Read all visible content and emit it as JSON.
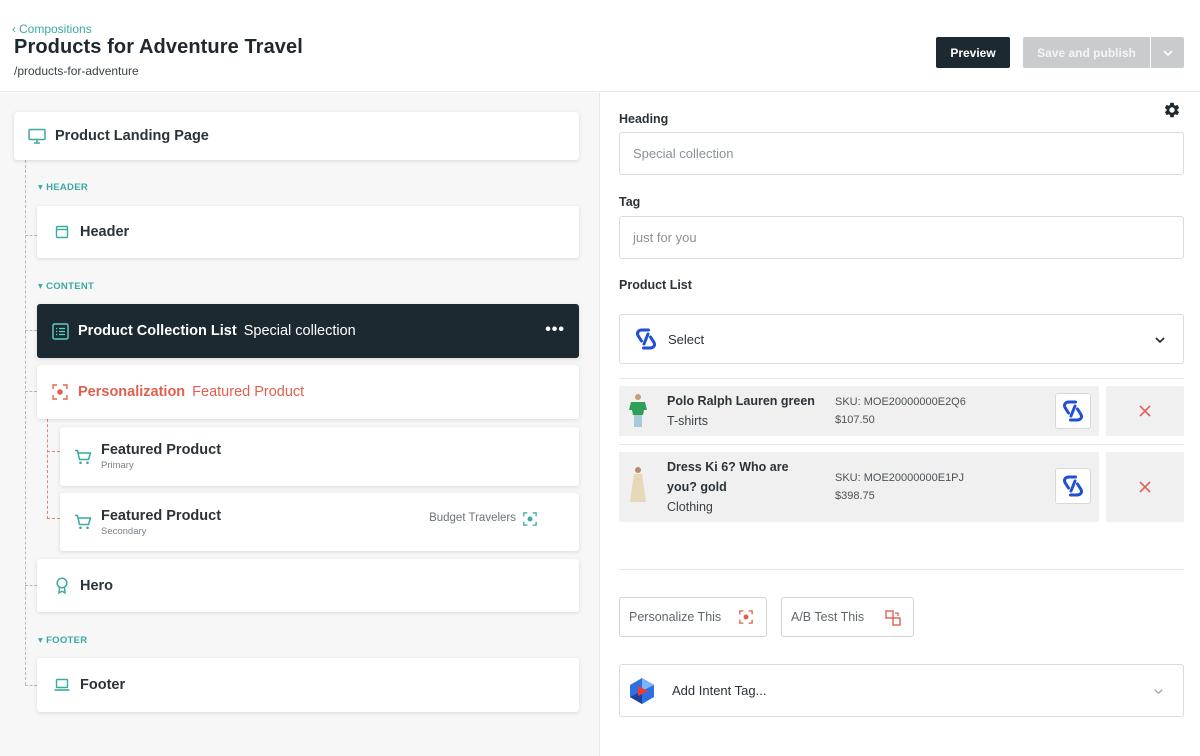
{
  "header": {
    "back_label": "Compositions",
    "title": "Products for Adventure Travel",
    "slug": "/products-for-adventure",
    "preview_label": "Preview",
    "publish_label": "Save and publish"
  },
  "tree": {
    "root_label": "Product Landing Page",
    "section_header": "HEADER",
    "section_content": "CONTENT",
    "section_footer": "FOOTER",
    "header_label": "Header",
    "collection_label": "Product Collection List",
    "collection_extra": "Special collection",
    "personalization_label": "Personalization",
    "personalization_extra": "Featured Product",
    "featured_primary_label": "Featured Product",
    "featured_primary_sub": "Primary",
    "featured_secondary_label": "Featured Product",
    "featured_secondary_sub": "Secondary",
    "featured_secondary_audience": "Budget Travelers",
    "hero_label": "Hero",
    "footer_label": "Footer"
  },
  "editor": {
    "heading_label": "Heading",
    "heading_value": "Special collection",
    "tag_label": "Tag",
    "tag_value": "just for you",
    "product_list_label": "Product List",
    "select_label": "Select",
    "products": [
      {
        "name": "Polo Ralph Lauren green",
        "category": "T-shirts",
        "sku": "SKU: MOE20000000E2Q6",
        "price": "$107.50"
      },
      {
        "name": "Dress Ki 6? Who are you? gold",
        "category": "Clothing",
        "sku": "SKU: MOE20000000E1PJ",
        "price": "$398.75"
      }
    ],
    "personalize_label": "Personalize This",
    "ab_test_label": "A/B Test This",
    "intent_tag_label": "Add Intent Tag..."
  },
  "colors": {
    "accent_teal": "#3aa9a0",
    "dark_navy": "#1c2930",
    "personalization_red": "#e0604f",
    "brand_blue": "#1f4fd6"
  }
}
